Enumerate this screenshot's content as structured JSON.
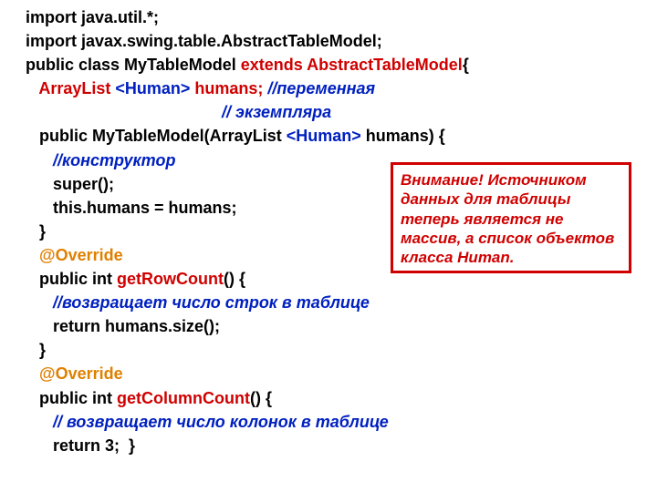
{
  "code": {
    "l1": "import java.util.*;",
    "l2": "import javax.swing.table.AbstractTableModel;",
    "l3a": "public class MyTableModel ",
    "l3b": "extends ",
    "l3c": "AbstractTableModel",
    "l3d": "{",
    "l4a": "   ArrayList ",
    "l4b": "<Human>",
    "l4c": " humans;",
    "l4d": " //переменная",
    "l5": "                                           // экземпляра",
    "l6a": "   public MyTableModel(ArrayList ",
    "l6b": "<Human>",
    "l6c": " humans) {",
    "l7": "      //конструктор",
    "l8": "      super();",
    "l9": "      this.humans = humans;",
    "l10": "   }",
    "l11a": "   ",
    "l11b": "@Override",
    "l12a": "   public int ",
    "l12b": "getRowCount",
    "l12c": "() {",
    "l13": "      //возвращает число строк в таблице",
    "l14": "      return humans.size();",
    "l15": "   }",
    "l16a": "   ",
    "l16b": "@Override",
    "l17a": "   public int ",
    "l17b": "getColumnCount",
    "l17c": "() {",
    "l18": "      // возвращает число колонок в таблице",
    "l19": "      return 3;  }"
  },
  "callout": {
    "text": "Внимание! Источником данных для таблицы теперь является не массив, а список объектов класса Human."
  }
}
